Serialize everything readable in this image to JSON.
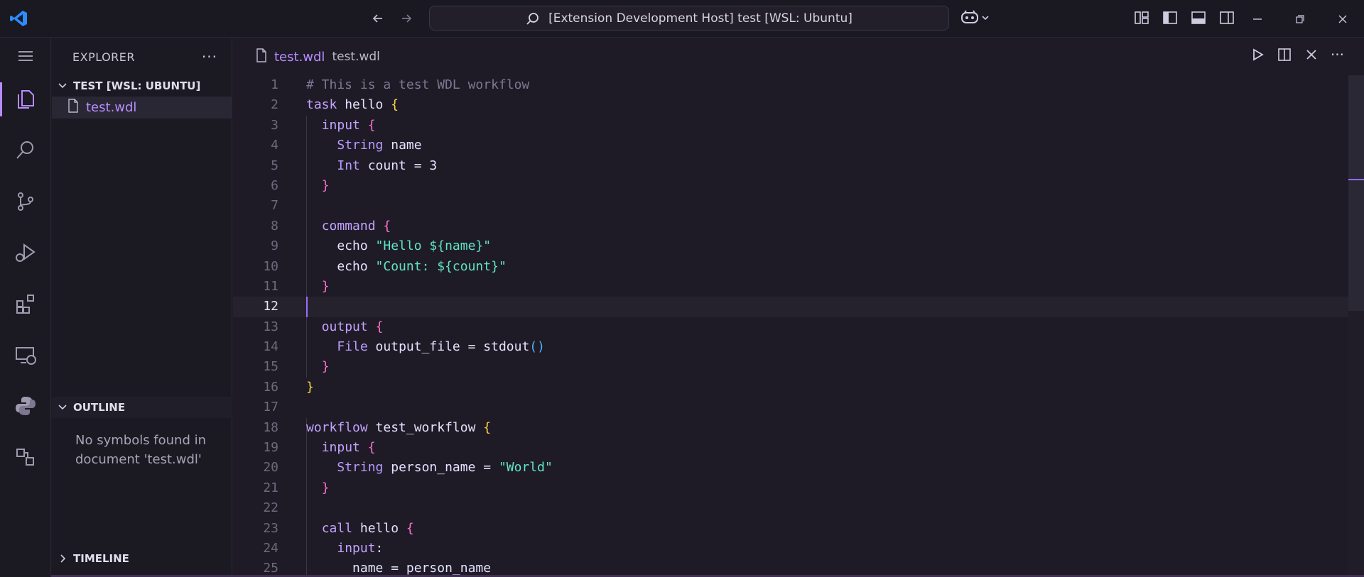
{
  "titlebar": {
    "search_text": "[Extension Development Host] test [WSL: Ubuntu]"
  },
  "sidebar": {
    "header": "EXPLORER",
    "workspace_title": "TEST [WSL: UBUNTU]",
    "file_name": "test.wdl",
    "outline_title": "OUTLINE",
    "outline_message": "No symbols found in document 'test.wdl'",
    "timeline_title": "TIMELINE"
  },
  "editor": {
    "tab_title": "test.wdl",
    "tab_description": "test.wdl",
    "lines": [
      {
        "no": "1",
        "segments": [
          {
            "c": "cm",
            "t": "# This is a test WDL workflow"
          }
        ]
      },
      {
        "no": "2",
        "segments": [
          {
            "c": "kw",
            "t": "task"
          },
          {
            "c": "pu",
            "t": " hello "
          },
          {
            "c": "br1",
            "t": "{"
          }
        ]
      },
      {
        "no": "3",
        "segments": [
          {
            "c": "pu",
            "t": "  "
          },
          {
            "c": "kw",
            "t": "input"
          },
          {
            "c": "pu",
            "t": " "
          },
          {
            "c": "br2",
            "t": "{"
          }
        ]
      },
      {
        "no": "4",
        "segments": [
          {
            "c": "pu",
            "t": "    "
          },
          {
            "c": "ty",
            "t": "String"
          },
          {
            "c": "pu",
            "t": " name"
          }
        ]
      },
      {
        "no": "5",
        "segments": [
          {
            "c": "pu",
            "t": "    "
          },
          {
            "c": "ty",
            "t": "Int"
          },
          {
            "c": "pu",
            "t": " count = 3"
          }
        ]
      },
      {
        "no": "6",
        "segments": [
          {
            "c": "pu",
            "t": "  "
          },
          {
            "c": "br2",
            "t": "}"
          }
        ]
      },
      {
        "no": "7",
        "segments": []
      },
      {
        "no": "8",
        "segments": [
          {
            "c": "pu",
            "t": "  "
          },
          {
            "c": "kw",
            "t": "command"
          },
          {
            "c": "pu",
            "t": " "
          },
          {
            "c": "br2",
            "t": "{"
          }
        ]
      },
      {
        "no": "9",
        "segments": [
          {
            "c": "pu",
            "t": "    echo "
          },
          {
            "c": "st",
            "t": "\"Hello ${name}\""
          }
        ]
      },
      {
        "no": "10",
        "segments": [
          {
            "c": "pu",
            "t": "    echo "
          },
          {
            "c": "st",
            "t": "\"Count: ${count}\""
          }
        ]
      },
      {
        "no": "11",
        "segments": [
          {
            "c": "pu",
            "t": "  "
          },
          {
            "c": "br2",
            "t": "}"
          }
        ]
      },
      {
        "no": "12",
        "segments": [],
        "current": true
      },
      {
        "no": "13",
        "segments": [
          {
            "c": "pu",
            "t": "  "
          },
          {
            "c": "kw",
            "t": "output"
          },
          {
            "c": "pu",
            "t": " "
          },
          {
            "c": "br2",
            "t": "{"
          }
        ]
      },
      {
        "no": "14",
        "segments": [
          {
            "c": "pu",
            "t": "    "
          },
          {
            "c": "ty",
            "t": "File"
          },
          {
            "c": "pu",
            "t": " output_file = stdout"
          },
          {
            "c": "br3",
            "t": "()"
          }
        ]
      },
      {
        "no": "15",
        "segments": [
          {
            "c": "pu",
            "t": "  "
          },
          {
            "c": "br2",
            "t": "}"
          }
        ]
      },
      {
        "no": "16",
        "segments": [
          {
            "c": "br1",
            "t": "}"
          }
        ]
      },
      {
        "no": "17",
        "segments": []
      },
      {
        "no": "18",
        "segments": [
          {
            "c": "kw",
            "t": "workflow"
          },
          {
            "c": "pu",
            "t": " test_workflow "
          },
          {
            "c": "br1",
            "t": "{"
          }
        ]
      },
      {
        "no": "19",
        "segments": [
          {
            "c": "pu",
            "t": "  "
          },
          {
            "c": "kw",
            "t": "input"
          },
          {
            "c": "pu",
            "t": " "
          },
          {
            "c": "br2",
            "t": "{"
          }
        ]
      },
      {
        "no": "20",
        "segments": [
          {
            "c": "pu",
            "t": "    "
          },
          {
            "c": "ty",
            "t": "String"
          },
          {
            "c": "pu",
            "t": " person_name = "
          },
          {
            "c": "st",
            "t": "\"World\""
          }
        ]
      },
      {
        "no": "21",
        "segments": [
          {
            "c": "pu",
            "t": "  "
          },
          {
            "c": "br2",
            "t": "}"
          }
        ]
      },
      {
        "no": "22",
        "segments": []
      },
      {
        "no": "23",
        "segments": [
          {
            "c": "pu",
            "t": "  "
          },
          {
            "c": "kw",
            "t": "call"
          },
          {
            "c": "pu",
            "t": " hello "
          },
          {
            "c": "br2",
            "t": "{"
          }
        ]
      },
      {
        "no": "24",
        "segments": [
          {
            "c": "pu",
            "t": "    "
          },
          {
            "c": "kw",
            "t": "input"
          },
          {
            "c": "pu",
            "t": ":"
          }
        ]
      },
      {
        "no": "25",
        "segments": [
          {
            "c": "pu",
            "t": "      name = person_name"
          }
        ]
      }
    ]
  }
}
